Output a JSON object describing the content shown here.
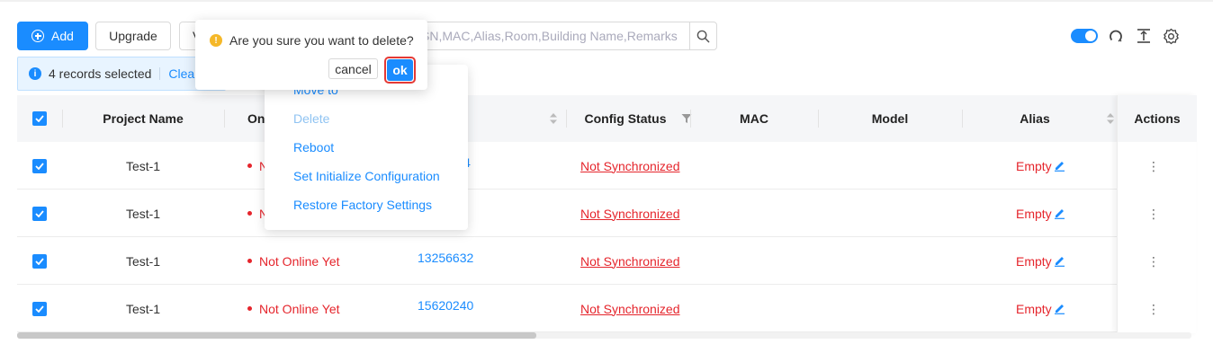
{
  "toolbar": {
    "add_label": "Add",
    "upgrade_label": "Upgrade",
    "third_button_partial": "V",
    "search_placeholder": "SN,MAC,Alias,Room,Building Name,Remarks"
  },
  "selection": {
    "text": "4 records selected",
    "clear_label": "Clear"
  },
  "table": {
    "headers": {
      "project_name": "Project Name",
      "online_partial": "On",
      "config_status": "Config Status",
      "mac": "MAC",
      "model": "Model",
      "alias": "Alias",
      "actions": "Actions"
    },
    "rows": [
      {
        "project": "Test-1",
        "status": "Not Online Yet",
        "status_partial": "N",
        "sn_partial": "4",
        "sn": "",
        "config": "Not Synchronized",
        "mac": "",
        "model": "",
        "alias": "Empty"
      },
      {
        "project": "Test-1",
        "status": "Not Online Yet",
        "status_partial": "N",
        "sn_partial": "",
        "sn": "",
        "config": "Not Synchronized",
        "mac": "",
        "model": "",
        "alias": "Empty"
      },
      {
        "project": "Test-1",
        "status": "Not Online Yet",
        "sn": "13256632",
        "config": "Not Synchronized",
        "mac": "",
        "model": "",
        "alias": "Empty"
      },
      {
        "project": "Test-1",
        "status": "Not Online Yet",
        "sn": "15620240",
        "config": "Not Synchronized",
        "mac": "",
        "model": "",
        "alias": "Empty"
      }
    ]
  },
  "dropdown": {
    "items": [
      {
        "label": "Move to",
        "disabled": false
      },
      {
        "label": "Delete",
        "disabled": true
      },
      {
        "label": "Reboot",
        "disabled": false
      },
      {
        "label": "Set Initialize Configuration",
        "disabled": false
      },
      {
        "label": "Restore Factory Settings",
        "disabled": false
      }
    ]
  },
  "popconfirm": {
    "message": "Are you sure you want to delete?",
    "cancel_label": "cancel",
    "ok_label": "ok"
  },
  "colors": {
    "primary": "#1a8cff",
    "danger": "#e5252c",
    "warning": "#f5b829",
    "highlight_ring": "#e53935"
  },
  "icons": [
    "plus-circle-icon",
    "search-icon",
    "toggle-switch",
    "refresh-icon",
    "vertical-align-icon",
    "gear-icon",
    "info-icon",
    "checkbox-checked-icon",
    "sort-icon",
    "filter-icon",
    "edit-pencil-icon",
    "more-vertical-icon",
    "warning-icon"
  ]
}
